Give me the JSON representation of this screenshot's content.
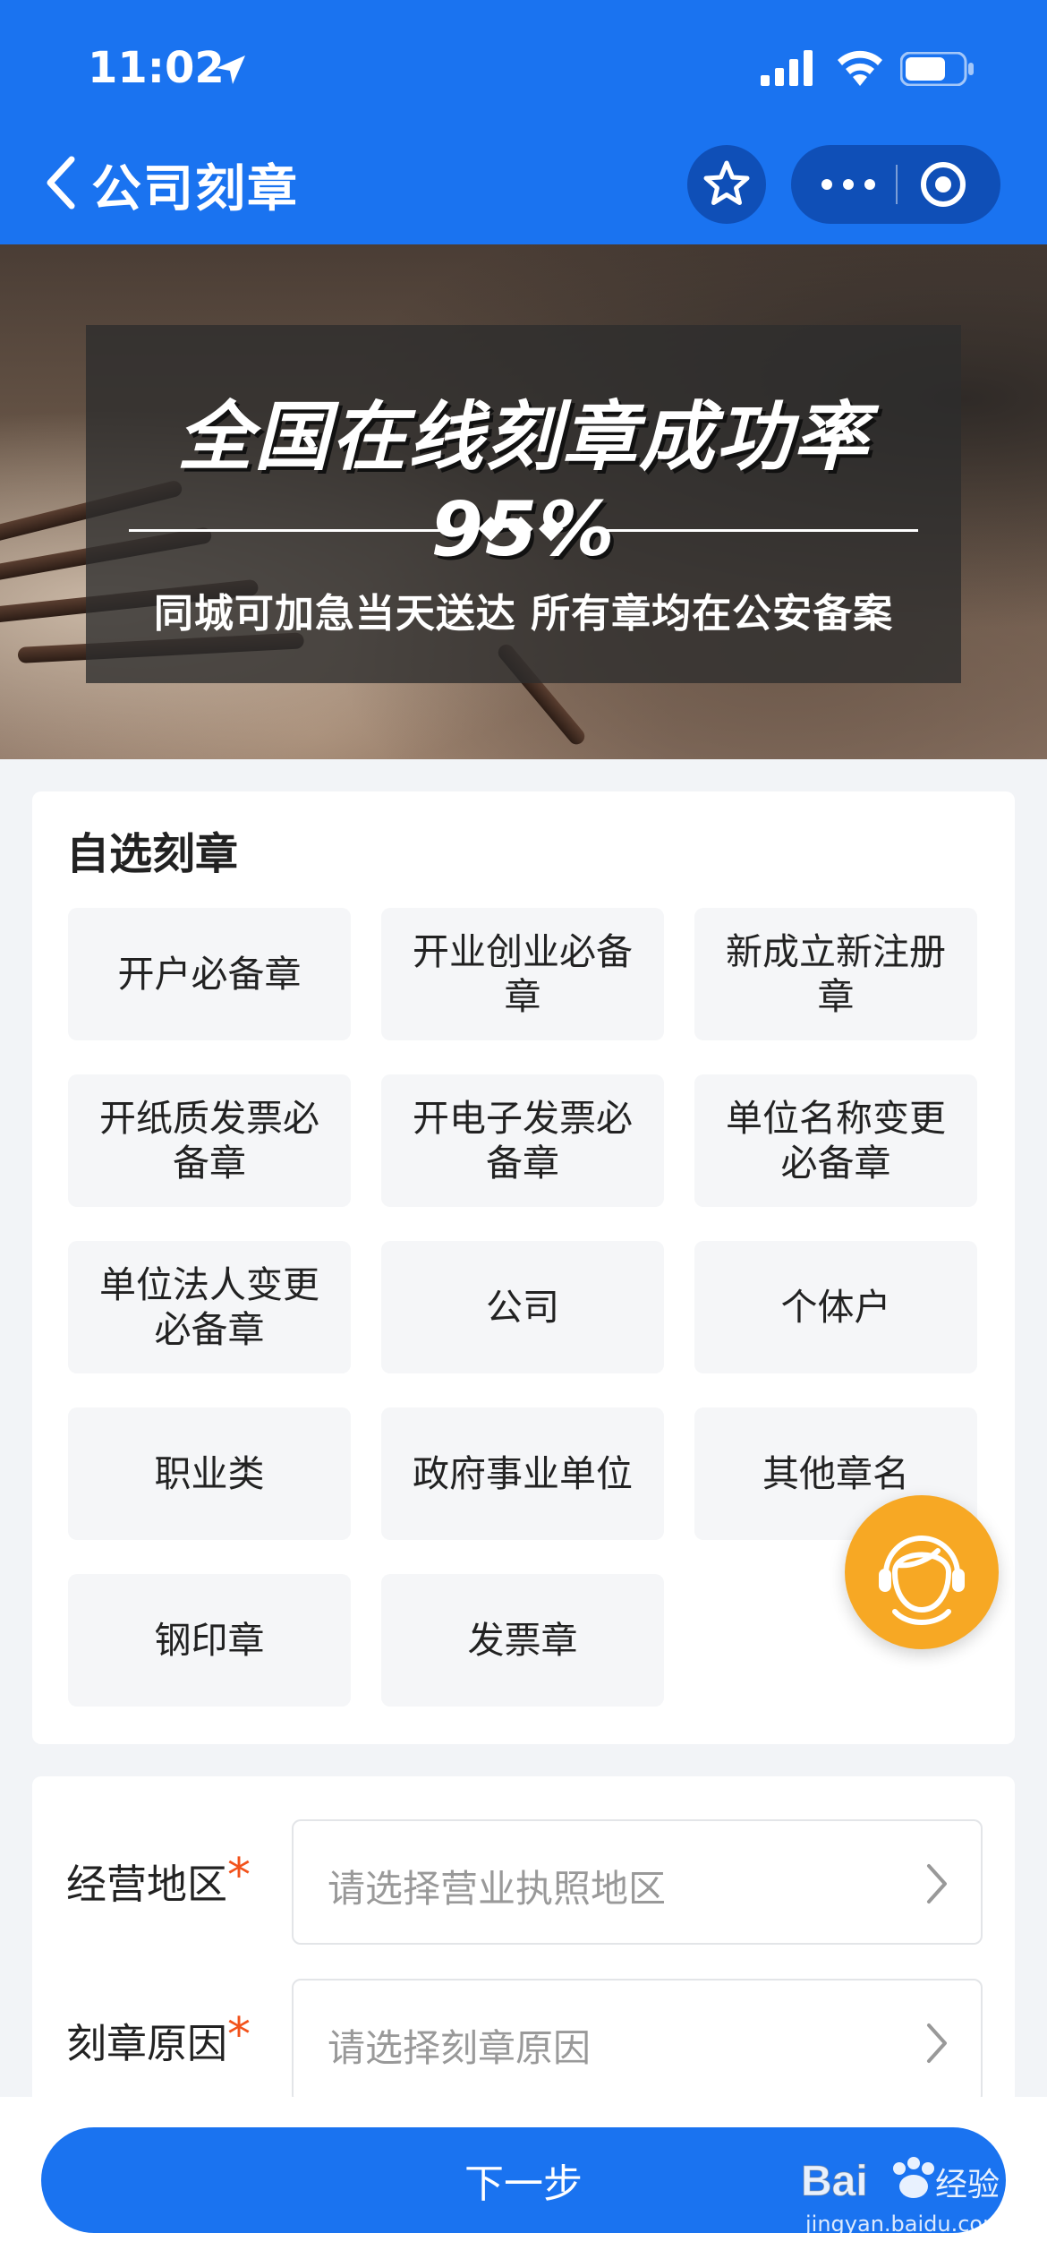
{
  "status": {
    "time": "11:02"
  },
  "nav": {
    "title": "公司刻章"
  },
  "banner": {
    "title": "全国在线刻章成功率95%",
    "diamonds": "◆◆◆",
    "subtitle": "同城可加急当天送达 所有章均在公安备案"
  },
  "seal_section": {
    "title": "自选刻章",
    "options": [
      "开户必备章",
      "开业创业必备章",
      "新成立新注册章",
      "开纸质发票必备章",
      "开电子发票必备章",
      "单位名称变更必备章",
      "单位法人变更必备章",
      "公司",
      "个体户",
      "职业类",
      "政府事业单位",
      "其他章名",
      "钢印章",
      "发票章"
    ]
  },
  "form": {
    "region_label": "经营地区",
    "region_placeholder": "请选择营业执照地区",
    "reason_label": "刻章原因",
    "reason_placeholder": "请选择刻章原因",
    "required_mark": "*"
  },
  "footer": {
    "next_label": "下一步"
  },
  "watermark": {
    "brand": "Baidu经验",
    "url": "jingyan.baidu.com"
  },
  "colors": {
    "primary": "#1a73f0",
    "accent": "#f7a824",
    "required": "#f2521b"
  }
}
